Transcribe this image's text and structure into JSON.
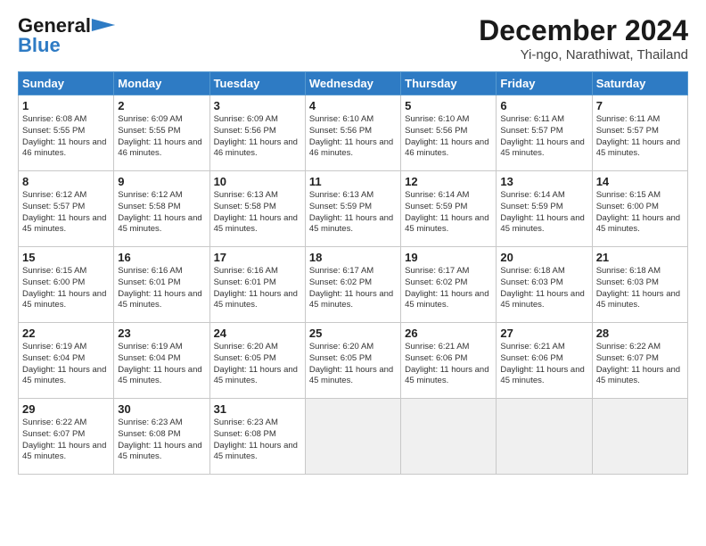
{
  "header": {
    "logo_line1": "General",
    "logo_line2": "Blue",
    "title": "December 2024",
    "subtitle": "Yi-ngo, Narathiwat, Thailand"
  },
  "calendar": {
    "headers": [
      "Sunday",
      "Monday",
      "Tuesday",
      "Wednesday",
      "Thursday",
      "Friday",
      "Saturday"
    ],
    "weeks": [
      [
        null,
        {
          "day": 2,
          "sunrise": "6:09 AM",
          "sunset": "5:55 PM",
          "daylight": "11 hours and 46 minutes."
        },
        {
          "day": 3,
          "sunrise": "6:09 AM",
          "sunset": "5:56 PM",
          "daylight": "11 hours and 46 minutes."
        },
        {
          "day": 4,
          "sunrise": "6:10 AM",
          "sunset": "5:56 PM",
          "daylight": "11 hours and 46 minutes."
        },
        {
          "day": 5,
          "sunrise": "6:10 AM",
          "sunset": "5:56 PM",
          "daylight": "11 hours and 46 minutes."
        },
        {
          "day": 6,
          "sunrise": "6:11 AM",
          "sunset": "5:57 PM",
          "daylight": "11 hours and 45 minutes."
        },
        {
          "day": 7,
          "sunrise": "6:11 AM",
          "sunset": "5:57 PM",
          "daylight": "11 hours and 45 minutes."
        }
      ],
      [
        {
          "day": 1,
          "sunrise": "6:08 AM",
          "sunset": "5:55 PM",
          "daylight": "11 hours and 46 minutes."
        },
        {
          "day": 8,
          "sunrise": "6:12 AM",
          "sunset": "5:57 PM",
          "daylight": "11 hours and 45 minutes."
        },
        {
          "day": 9,
          "sunrise": "6:12 AM",
          "sunset": "5:58 PM",
          "daylight": "11 hours and 45 minutes."
        },
        {
          "day": 10,
          "sunrise": "6:13 AM",
          "sunset": "5:58 PM",
          "daylight": "11 hours and 45 minutes."
        },
        {
          "day": 11,
          "sunrise": "6:13 AM",
          "sunset": "5:59 PM",
          "daylight": "11 hours and 45 minutes."
        },
        {
          "day": 12,
          "sunrise": "6:14 AM",
          "sunset": "5:59 PM",
          "daylight": "11 hours and 45 minutes."
        },
        {
          "day": 13,
          "sunrise": "6:14 AM",
          "sunset": "5:59 PM",
          "daylight": "11 hours and 45 minutes."
        },
        {
          "day": 14,
          "sunrise": "6:15 AM",
          "sunset": "6:00 PM",
          "daylight": "11 hours and 45 minutes."
        }
      ],
      [
        {
          "day": 15,
          "sunrise": "6:15 AM",
          "sunset": "6:00 PM",
          "daylight": "11 hours and 45 minutes."
        },
        {
          "day": 16,
          "sunrise": "6:16 AM",
          "sunset": "6:01 PM",
          "daylight": "11 hours and 45 minutes."
        },
        {
          "day": 17,
          "sunrise": "6:16 AM",
          "sunset": "6:01 PM",
          "daylight": "11 hours and 45 minutes."
        },
        {
          "day": 18,
          "sunrise": "6:17 AM",
          "sunset": "6:02 PM",
          "daylight": "11 hours and 45 minutes."
        },
        {
          "day": 19,
          "sunrise": "6:17 AM",
          "sunset": "6:02 PM",
          "daylight": "11 hours and 45 minutes."
        },
        {
          "day": 20,
          "sunrise": "6:18 AM",
          "sunset": "6:03 PM",
          "daylight": "11 hours and 45 minutes."
        },
        {
          "day": 21,
          "sunrise": "6:18 AM",
          "sunset": "6:03 PM",
          "daylight": "11 hours and 45 minutes."
        }
      ],
      [
        {
          "day": 22,
          "sunrise": "6:19 AM",
          "sunset": "6:04 PM",
          "daylight": "11 hours and 45 minutes."
        },
        {
          "day": 23,
          "sunrise": "6:19 AM",
          "sunset": "6:04 PM",
          "daylight": "11 hours and 45 minutes."
        },
        {
          "day": 24,
          "sunrise": "6:20 AM",
          "sunset": "6:05 PM",
          "daylight": "11 hours and 45 minutes."
        },
        {
          "day": 25,
          "sunrise": "6:20 AM",
          "sunset": "6:05 PM",
          "daylight": "11 hours and 45 minutes."
        },
        {
          "day": 26,
          "sunrise": "6:21 AM",
          "sunset": "6:06 PM",
          "daylight": "11 hours and 45 minutes."
        },
        {
          "day": 27,
          "sunrise": "6:21 AM",
          "sunset": "6:06 PM",
          "daylight": "11 hours and 45 minutes."
        },
        {
          "day": 28,
          "sunrise": "6:22 AM",
          "sunset": "6:07 PM",
          "daylight": "11 hours and 45 minutes."
        }
      ],
      [
        {
          "day": 29,
          "sunrise": "6:22 AM",
          "sunset": "6:07 PM",
          "daylight": "11 hours and 45 minutes."
        },
        {
          "day": 30,
          "sunrise": "6:23 AM",
          "sunset": "6:08 PM",
          "daylight": "11 hours and 45 minutes."
        },
        {
          "day": 31,
          "sunrise": "6:23 AM",
          "sunset": "6:08 PM",
          "daylight": "11 hours and 45 minutes."
        },
        null,
        null,
        null,
        null
      ]
    ]
  }
}
